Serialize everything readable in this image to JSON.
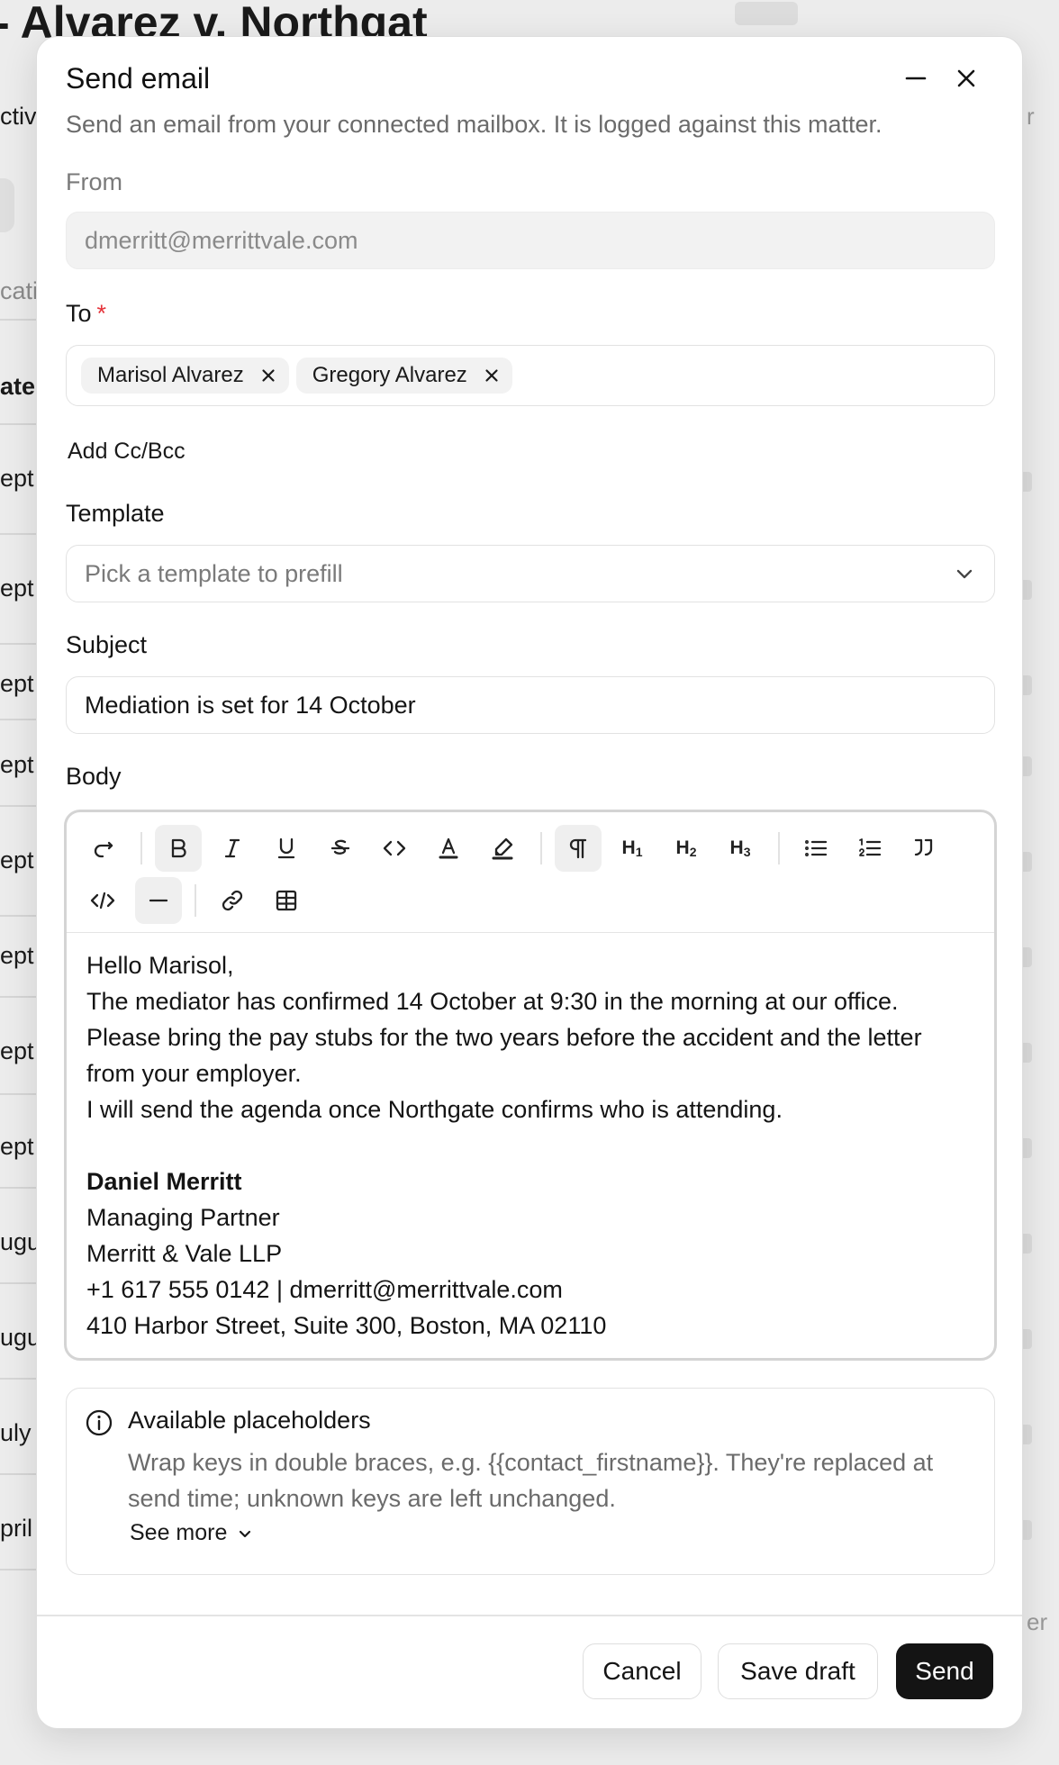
{
  "background": {
    "page_title": "- Alvarez v. Northgat",
    "left_labels": [
      {
        "text": "ctiv",
        "muted": false
      },
      {
        "text": "catio",
        "muted": true
      },
      {
        "text": "ate",
        "muted": false,
        "bold": true
      },
      {
        "text": "ept",
        "muted": false
      },
      {
        "text": "ept",
        "muted": false
      },
      {
        "text": "ept",
        "muted": false
      },
      {
        "text": "ept",
        "muted": false
      },
      {
        "text": "ept",
        "muted": false
      },
      {
        "text": "ept",
        "muted": false
      },
      {
        "text": "ept",
        "muted": false
      },
      {
        "text": "ept",
        "muted": false
      },
      {
        "text": "ugu",
        "muted": false
      },
      {
        "text": "ugu",
        "muted": false
      },
      {
        "text": "uly",
        "muted": false
      },
      {
        "text": "pril",
        "muted": false
      }
    ],
    "right_fragments": [
      "r",
      "er"
    ]
  },
  "modal": {
    "title": "Send email",
    "description": "Send an email from your connected mailbox. It is logged against this matter.",
    "icons": {
      "minimize": "minimize-icon",
      "close": "close-icon"
    },
    "from": {
      "label": "From",
      "value": "dmerritt@merrittvale.com"
    },
    "to": {
      "label": "To",
      "required_mark": "*",
      "recipients": [
        "Marisol Alvarez",
        "Gregory Alvarez"
      ]
    },
    "add_cc_bcc": "Add Cc/Bcc",
    "template": {
      "label": "Template",
      "placeholder": "Pick a template to prefill"
    },
    "subject": {
      "label": "Subject",
      "value": "Mediation is set for 14 October"
    },
    "body": {
      "label": "Body",
      "toolbar": {
        "h1": "H",
        "h1_sub": "1",
        "h2": "H",
        "h2_sub": "2",
        "h3": "H",
        "h3_sub": "3"
      },
      "lines": [
        "Hello Marisol,",
        "The mediator has confirmed 14 October at 9:30 in the morning at our office.",
        "Please bring the pay stubs for the two years before the accident and the letter from your employer.",
        "I will send the agenda once Northgate confirms who is attending."
      ],
      "signature": {
        "name": "Daniel Merritt",
        "role": "Managing Partner",
        "firm": "Merritt & Vale LLP",
        "contact": "+1 617 555 0142 | dmerritt@merrittvale.com",
        "address": "410 Harbor Street, Suite 300, Boston, MA 02110"
      }
    },
    "placeholders": {
      "title": "Available placeholders",
      "text": "Wrap keys in double braces, e.g. {{contact_firstname}}. They're replaced at send time; unknown keys are left unchanged.",
      "see_more": "See more"
    },
    "footer": {
      "cancel": "Cancel",
      "save_draft": "Save draft",
      "send": "Send"
    }
  }
}
